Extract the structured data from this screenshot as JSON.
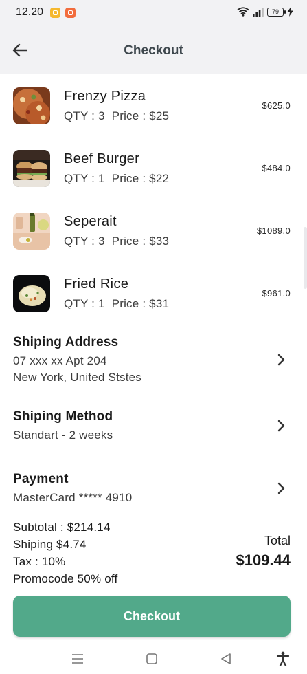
{
  "status_bar": {
    "time": "12.20",
    "battery": "79"
  },
  "header": {
    "title": "Checkout"
  },
  "items": [
    {
      "name": "Frenzy Pizza",
      "qty": "QTY : 3",
      "price": "Price : $25",
      "amount": "$625.0",
      "thumb": "pizza"
    },
    {
      "name": "Beef Burger",
      "qty": "QTY : 1",
      "price": "Price : $22",
      "amount": "$484.0",
      "thumb": "burger"
    },
    {
      "name": "Seperait",
      "qty": "QTY : 3",
      "price": "Price : $33",
      "amount": "$1089.0",
      "thumb": "drink"
    },
    {
      "name": "Fried Rice",
      "qty": "QTY : 1",
      "price": "Price : $31",
      "amount": "$961.0",
      "thumb": "rice"
    }
  ],
  "shipping_address": {
    "title": "Shiping Address",
    "line1": "07 xxx xx Apt 204",
    "line2": "New York, United Ststes"
  },
  "shipping_method": {
    "title": "Shiping Method",
    "value": "Standart - 2 weeks"
  },
  "payment": {
    "title": "Payment",
    "value": "MasterCard ***** 4910"
  },
  "summary": {
    "subtotal": "Subtotal : $214.14",
    "shipping": "Shiping $4.74",
    "tax": "Tax : 10%",
    "promocode": "Promocode 50% off",
    "total_label": "Total",
    "total_value": "$109.44"
  },
  "checkout_button": "Checkout",
  "colors": {
    "accent": "#52a98a",
    "header_bg": "#f2f2f4",
    "title_text": "#3e474d"
  },
  "icons": [
    "back-arrow-icon",
    "chevron-right-icon",
    "wifi-icon",
    "signal-icon",
    "battery-icon",
    "menu-icon",
    "home-icon",
    "back-triangle-icon",
    "accessibility-icon"
  ]
}
